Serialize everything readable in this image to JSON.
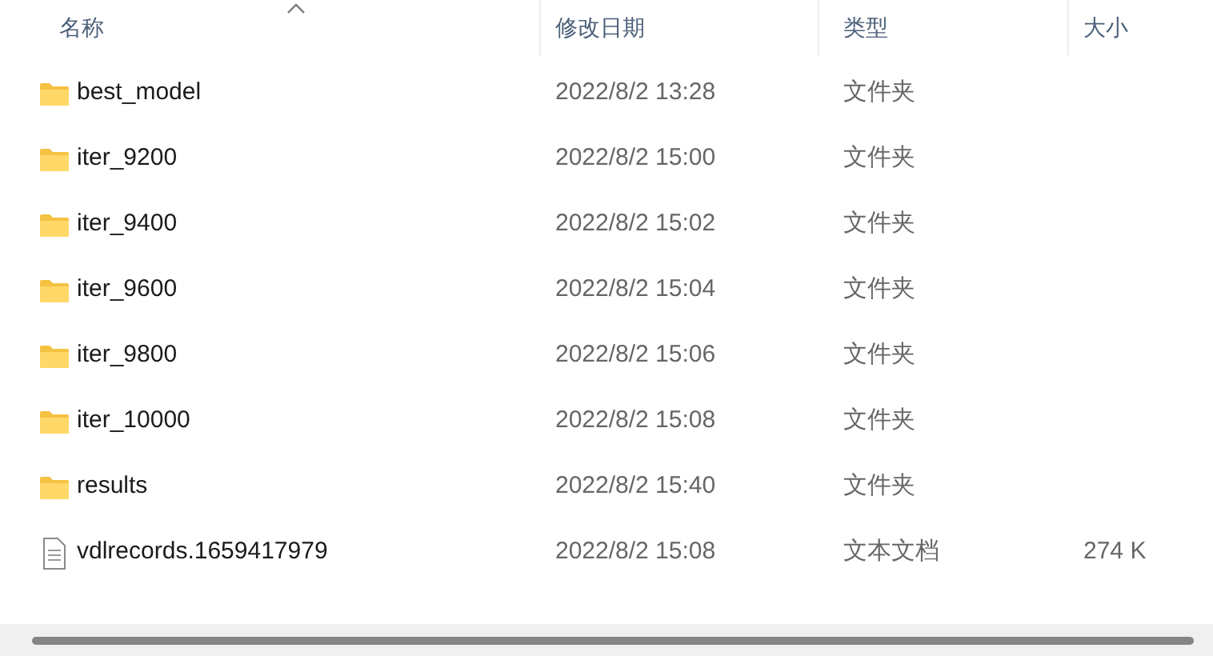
{
  "columns": [
    {
      "label": "名称",
      "sorted": true
    },
    {
      "label": "修改日期",
      "sorted": false
    },
    {
      "label": "类型",
      "sorted": false
    },
    {
      "label": "大小",
      "sorted": false
    }
  ],
  "rows": [
    {
      "kind": "folder",
      "name": "best_model",
      "date": "2022/8/2 13:28",
      "type": "文件夹"
    },
    {
      "kind": "folder",
      "name": "iter_9200",
      "date": "2022/8/2 15:00",
      "type": "文件夹"
    },
    {
      "kind": "folder",
      "name": "iter_9400",
      "date": "2022/8/2 15:02",
      "type": "文件夹"
    },
    {
      "kind": "folder",
      "name": "iter_9600",
      "date": "2022/8/2 15:04",
      "type": "文件夹"
    },
    {
      "kind": "folder",
      "name": "iter_9800",
      "date": "2022/8/2 15:06",
      "type": "文件夹"
    },
    {
      "kind": "folder",
      "name": "iter_10000",
      "date": "2022/8/2 15:08",
      "type": "文件夹"
    },
    {
      "kind": "folder",
      "name": "results",
      "date": "2022/8/2 15:40",
      "type": "文件夹"
    },
    {
      "kind": "file",
      "name": "vdlrecords.1659417979",
      "date": "2022/8/2 15:08",
      "type": "文本文档",
      "size": "274 K"
    }
  ]
}
